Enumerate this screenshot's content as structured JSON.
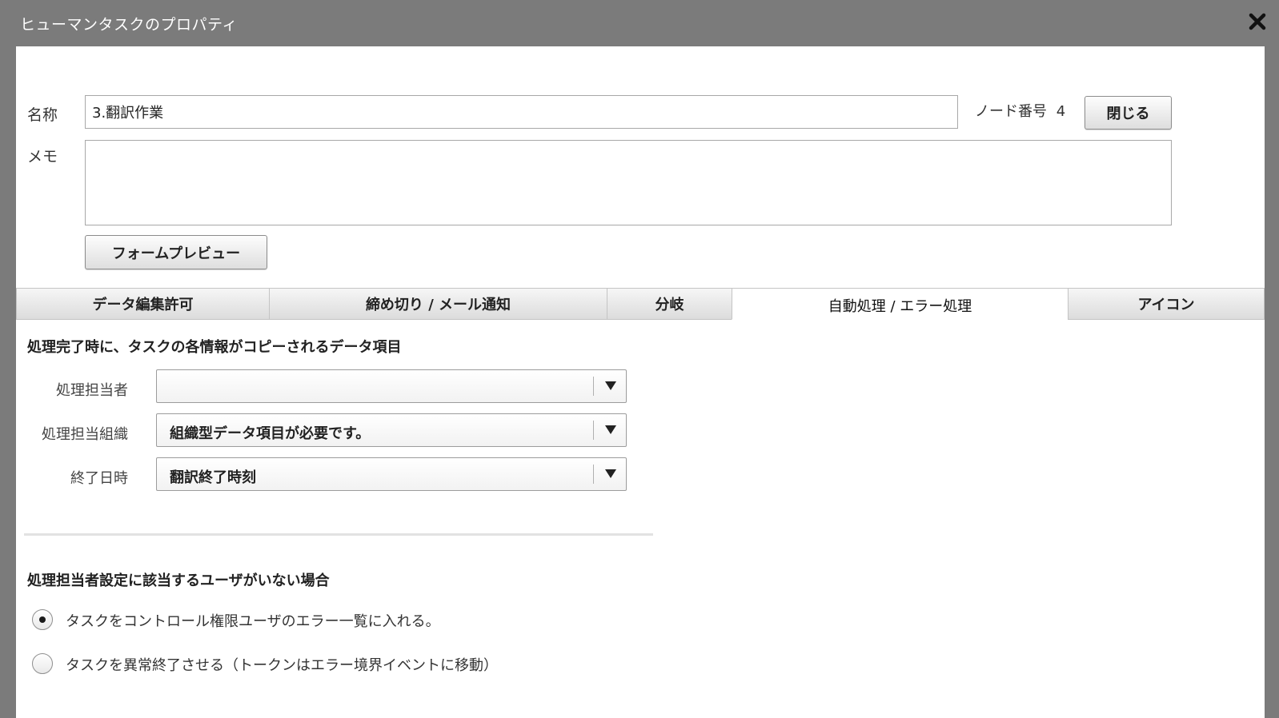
{
  "window": {
    "title": "ヒューマンタスクのプロパティ",
    "close_icon": "close-icon"
  },
  "form": {
    "name_label": "名称",
    "name_value": "3.翻訳作業",
    "node_number_label": "ノード番号",
    "node_number_value": "4",
    "close_button": "閉じる",
    "memo_label": "メモ",
    "memo_value": "",
    "form_preview_button": "フォームプレビュー"
  },
  "tabs": [
    {
      "label": "データ編集許可",
      "active": false
    },
    {
      "label": "締め切り / メール通知",
      "active": false
    },
    {
      "label": "分岐",
      "active": false
    },
    {
      "label": "自動処理 / エラー処理",
      "active": true
    },
    {
      "label": "アイコン",
      "active": false
    }
  ],
  "auto_processing": {
    "section_title": "処理完了時に、タスクの各情報がコピーされるデータ項目",
    "fields": [
      {
        "label": "処理担当者",
        "selected": ""
      },
      {
        "label": "処理担当組織",
        "selected": "組織型データ項目が必要です。"
      },
      {
        "label": "終了日時",
        "selected": "翻訳終了時刻"
      }
    ]
  },
  "error_processing": {
    "section_title": "処理担当者設定に該当するユーザがいない場合",
    "options": [
      {
        "label": "タスクをコントロール権限ユーザのエラー一覧に入れる。",
        "checked": true
      },
      {
        "label": "タスクを異常終了させる（トークンはエラー境界イベントに移動）",
        "checked": false
      }
    ]
  },
  "colors": {
    "titlebar": "#7b7b7b",
    "background": "#ffffff",
    "tab_inactive": "#dcdcdc"
  }
}
